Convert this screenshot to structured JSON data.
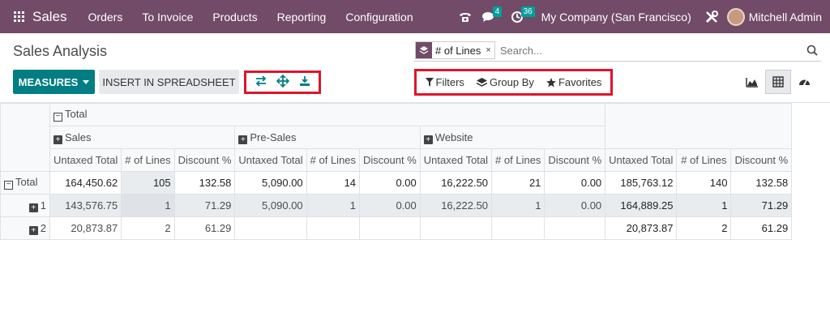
{
  "navbar": {
    "brand": "Sales",
    "menu": [
      "Orders",
      "To Invoice",
      "Products",
      "Reporting",
      "Configuration"
    ],
    "messages_badge": "4",
    "activities_badge": "36",
    "company": "My Company (San Francisco)",
    "user": "Mitchell Admin"
  },
  "page": {
    "title": "Sales Analysis"
  },
  "search": {
    "facet": "# of Lines",
    "facet_remove": "×",
    "placeholder": "Search..."
  },
  "toolbar": {
    "measures_label": "MEASURES",
    "spreadsheet_label": "INSERT IN SPREADSHEET"
  },
  "filters": {
    "filters_label": "Filters",
    "groupby_label": "Group By",
    "favorites_label": "Favorites"
  },
  "pivot": {
    "total_label": "Total",
    "groups": [
      "Sales",
      "Pre-Sales",
      "Website"
    ],
    "measures": [
      "Untaxed Total",
      "# of Lines",
      "Discount %"
    ],
    "rows": [
      {
        "label": "Total",
        "cells": [
          "164,450.62",
          "105",
          "132.58",
          "5,090.00",
          "14",
          "0.00",
          "16,222.50",
          "21",
          "0.00",
          "185,763.12",
          "140",
          "132.58"
        ]
      },
      {
        "label": "1",
        "cells": [
          "143,576.75",
          "1",
          "71.29",
          "5,090.00",
          "1",
          "0.00",
          "16,222.50",
          "1",
          "0.00",
          "164,889.25",
          "1",
          "71.29"
        ]
      },
      {
        "label": "2",
        "cells": [
          "20,873.87",
          "2",
          "61.29",
          "",
          "",
          "",
          "",
          "",
          "",
          "20,873.87",
          "2",
          "61.29"
        ]
      }
    ]
  },
  "colors": {
    "navbar": "#714b67",
    "primary": "#017e84",
    "highlight_border": "#e0142b",
    "badge": "#00a09d"
  }
}
